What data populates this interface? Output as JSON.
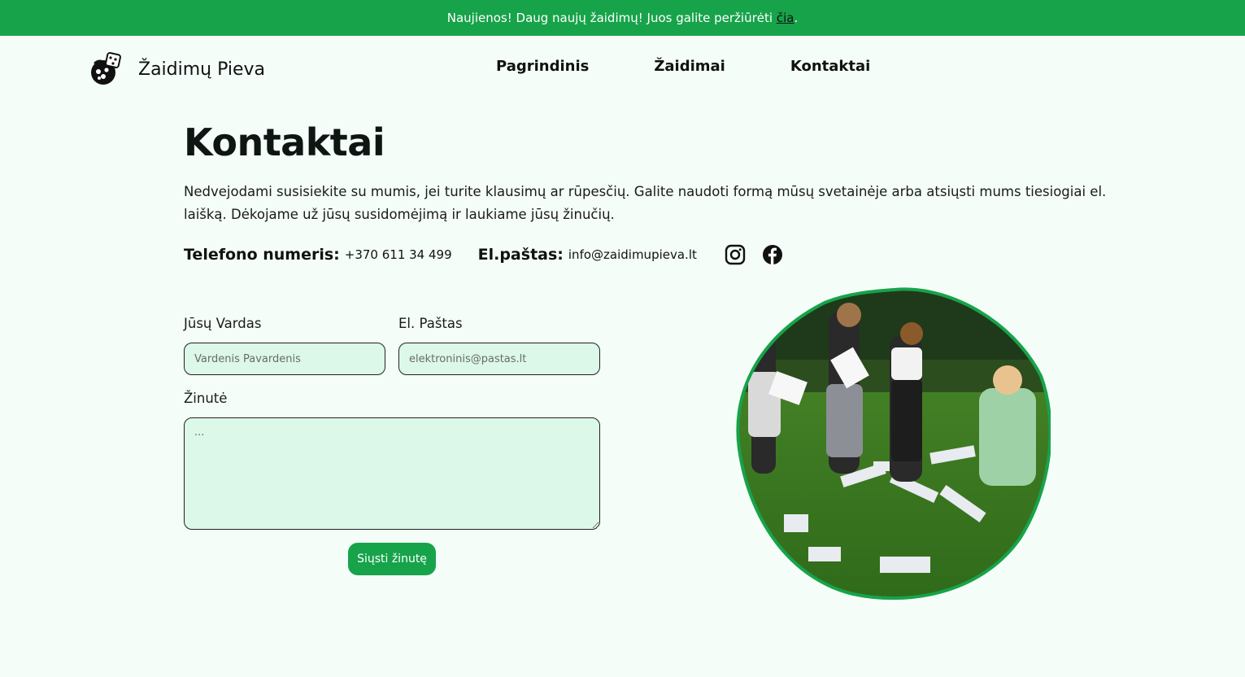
{
  "banner": {
    "text": "Naujienos! Daug naujų žaidimų! Juos galite peržiūrėti ",
    "link": "čia",
    "suffix": "."
  },
  "brand": {
    "name": "Žaidimų Pieva",
    "logo_icon": "dice-ball-logo-icon"
  },
  "nav": {
    "items": [
      {
        "label": "Pagrindinis"
      },
      {
        "label": "Žaidimai"
      },
      {
        "label": "Kontaktai"
      }
    ]
  },
  "page": {
    "title": "Kontaktai",
    "lead": "Nedvejodami susisiekite su mumis, jei turite klausimų ar rūpesčių. Galite naudoti formą mūsų svetainėje arba atsiųsti mums tiesiogiai el. laišką. Dėkojame už jūsų susidomėjimą ir laukiame jūsų žinučių."
  },
  "contacts": {
    "phone_label": "Telefono numeris:",
    "phone_value": "+370 611 34 499",
    "email_label": "El.paštas:",
    "email_value": "info@zaidimupieva.lt",
    "social": [
      "instagram-icon",
      "facebook-icon"
    ]
  },
  "form": {
    "name_label": "Jūsų Vardas",
    "name_placeholder": "Vardenis Pavardenis",
    "email_label": "El. Paštas",
    "email_placeholder": "elektroninis@pastas.lt",
    "message_label": "Žinutė",
    "message_placeholder": "...",
    "submit_label": "Siųsti žinutę"
  },
  "colors": {
    "accent": "#17a34a",
    "background": "#f4fdf8",
    "input_bg": "#dbf8e8"
  }
}
